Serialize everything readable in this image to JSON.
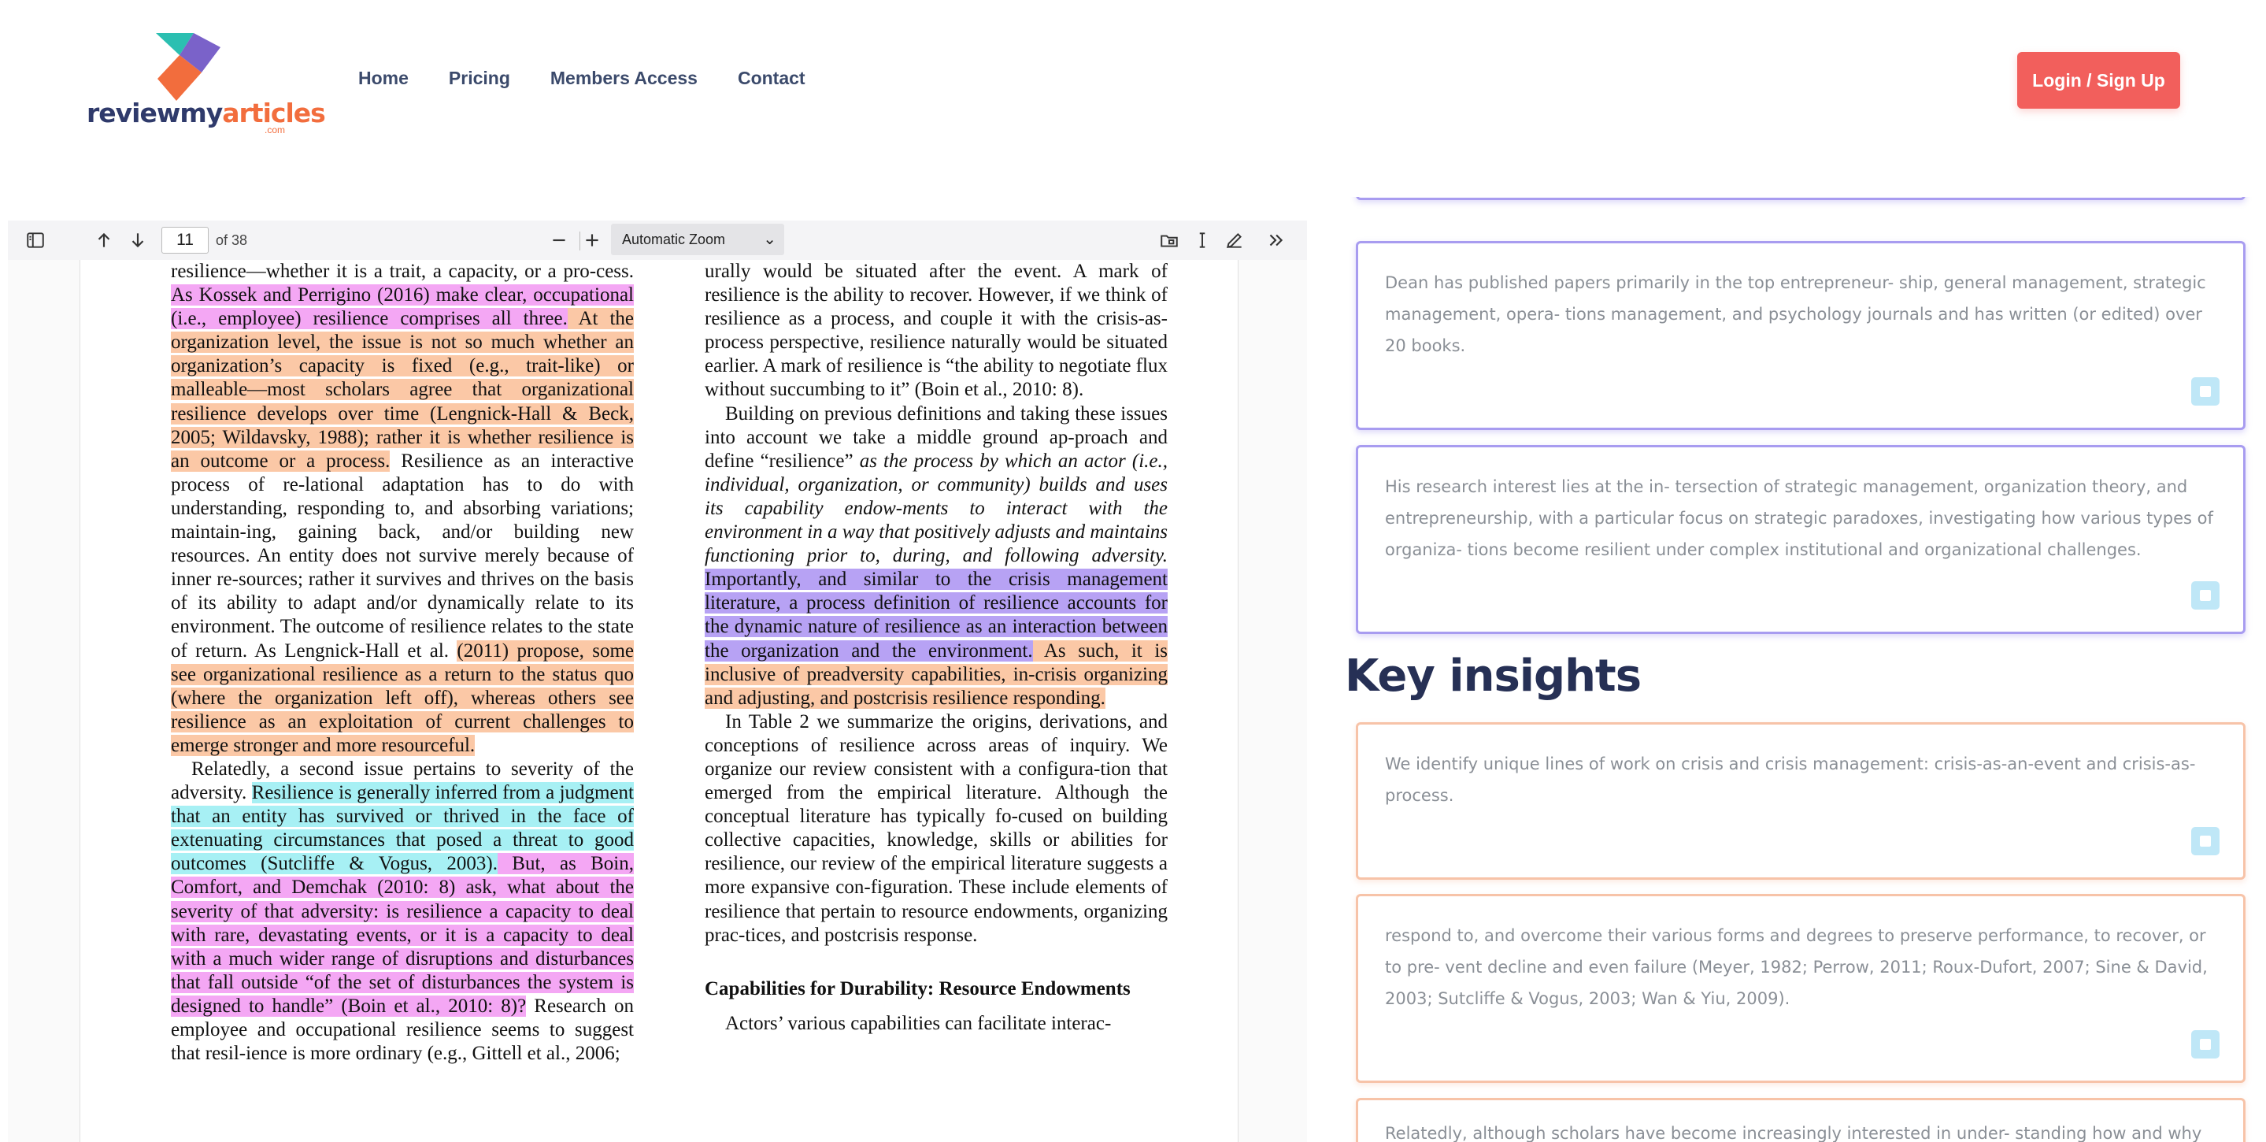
{
  "brand": {
    "name_main": "reviewmy",
    "name_accent": "articles",
    "tld": ".com"
  },
  "nav": [
    "Home",
    "Pricing",
    "Members Access",
    "Contact"
  ],
  "auth": {
    "login_label": "Login / Sign Up"
  },
  "pdf_toolbar": {
    "page_number": "11",
    "page_total": "of 38",
    "zoom": "Automatic Zoom"
  },
  "pdf": {
    "left": {
      "p1": [
        "resilience—whether it is a trait, a capacity, or a pro-cess. ",
        "As Kossek and Perrigino (2016) make clear, occupational (i.e., employee) resilience comprises all three.",
        " At the organization level, the issue is not so much whether an organization’s capacity is fixed (e.g., trait-like) or malleable—most scholars agree that organizational resilience develops over time (Lengnick-Hall & Beck, 2005; Wildavsky, 1988); rather it is whether resilience is an outcome or a process.",
        " Resilience as an interactive process of re-lational adaptation has to do with understanding, responding to, and absorbing variations; maintain-ing, gaining back, and/or building new resources. An entity does not survive merely because of inner re-sources; rather it survives and thrives on the basis of its ability to adapt and/or dynamically relate to its environment. The outcome of resilience relates to the state of return. As Lengnick-Hall et al. ",
        "(2011) propose, some see organizational resilience as a return to the status quo (where the organization left off), whereas others see resilience as an exploitation of current challenges to emerge stronger and more resourceful."
      ],
      "p2": [
        "Relatedly, a second issue pertains to severity of the adversity. ",
        "Resilience is generally inferred from a judgment that an entity has survived or thrived in the face of extenuating circumstances that posed a threat to good outcomes (Sutcliffe & Vogus, 2003).",
        " But, as Boin, Comfort, and Demchak (2010: 8) ask, what about the severity of that adversity: is resilience a capacity to deal with rare, devastating events, or it is a capacity to deal with a much wider range of disruptions and disturbances that fall outside “of the set of disturbances the system is designed to handle” (Boin et al., 2010: 8)?",
        " Research on employee and occupational resilience seems to suggest that resil-ience is more ordinary (e.g., Gittell et al., 2006;"
      ]
    },
    "right": {
      "p1": "urally would be situated after the event. A mark of resilience is the ability to recover. However, if we think of resilience as a process, and couple it with the crisis-as-process perspective, resilience naturally would be situated earlier. A mark of resilience is “the ability to negotiate flux without succumbing to it” (Boin et al., 2010: 8).",
      "p2": [
        "Building on previous definitions and taking these issues into account we take a middle ground ap-proach and define “resilience” ",
        "as the process by which an actor (i.e., individual, organization, or community) builds and uses its capability endow-ments to interact with the environment in a way that positively adjusts and maintains functioning prior to, during, and following adversity.",
        " ",
        "Importantly, and similar to the crisis management literature, a process definition of resilience accounts for the dynamic nature of resilience as an interaction between the organization and the environment.",
        " As such, it is inclusive of preadversity capabilities, in-crisis organizing and adjusting, and postcrisis resilience responding."
      ],
      "p3": "In Table 2 we summarize the origins, derivations, and conceptions of resilience across areas of inquiry. We organize our review consistent with a configura-tion that emerged from the empirical literature. Although the conceptual literature has typically fo-cused on building collective capacities, knowledge, skills or abilities for resilience, our review of the empirical literature suggests a more expansive con-figuration. These include elements of resilience that pertain to resource endowments, organizing prac-tices, and postcrisis response.",
      "heading": "Capabilities for Durability: Resource Endowments",
      "p4": "Actors’ various capabilities can facilitate interac-"
    }
  },
  "summary_cards": [
    "Dean has published papers primarily in the top entrepreneur- ship, general management, strategic management, opera- tions management, and psychology journals and has written (or edited) over 20 books.",
    "His research interest lies at the in- tersection of strategic management, organization theory, and entrepreneurship, with a particular focus on strategic paradoxes, investigating how various types of organiza- tions become resilient under complex institutional and organizational challenges."
  ],
  "key_insights_title": "Key insights",
  "insight_cards": [
    "We identify unique lines of work on crisis and crisis management: crisis-as-an-event and crisis-as-process.",
    "respond to, and overcome their various forms and degrees to preserve performance, to recover, or to pre- vent decline and even failure (Meyer, 1982; Perrow, 2011; Roux-Dufort, 2007; Sine & David, 2003; Sutcliffe & Vogus, 2003; Wan & Yiu, 2009).",
    "Relatedly, although scholars have become increasingly interested in under- standing how and why some"
  ],
  "icons": {
    "sidebar_toggle": "sidebar-toggle-icon",
    "prev": "arrow-up-icon",
    "next": "arrow-down-icon",
    "zoom_out": "minus-icon",
    "zoom_in": "plus-icon",
    "open": "folder-icon",
    "text": "text-cursor-icon",
    "draw": "pen-icon",
    "more": "double-chevron-right-icon",
    "copy": "copy-icon"
  },
  "colors": {
    "accent": "#f25f5c",
    "brand_dark": "#2f3a6b",
    "highlight_pink": "#f4a7f4",
    "highlight_orange": "#fbc8a6",
    "highlight_cyan": "#a7f0f4",
    "highlight_purple": "#b7a2f4",
    "card_purple": "#a89cf0",
    "card_orange": "#f7c3a8"
  }
}
